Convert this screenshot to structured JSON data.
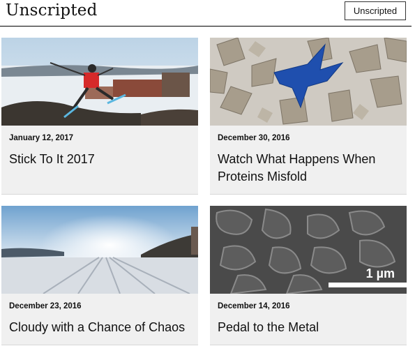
{
  "header": {
    "site_title": "Unscripted",
    "button_label": "Unscripted"
  },
  "cards": [
    {
      "date": "January 12, 2017",
      "title": "Stick To It 2017",
      "image": "skier-jumping-photo"
    },
    {
      "date": "December 30, 2016",
      "title": "Watch What Happens When Proteins Misfold",
      "image": "origami-cranes-photo"
    },
    {
      "date": "December 23, 2016",
      "title": "Cloudy with a Chance of Chaos",
      "image": "snowy-road-sky-photo"
    },
    {
      "date": "December 14, 2016",
      "title": "Pedal to the Metal",
      "image": "micrograph-photo",
      "scale_bar_label": "1 µm"
    }
  ]
}
